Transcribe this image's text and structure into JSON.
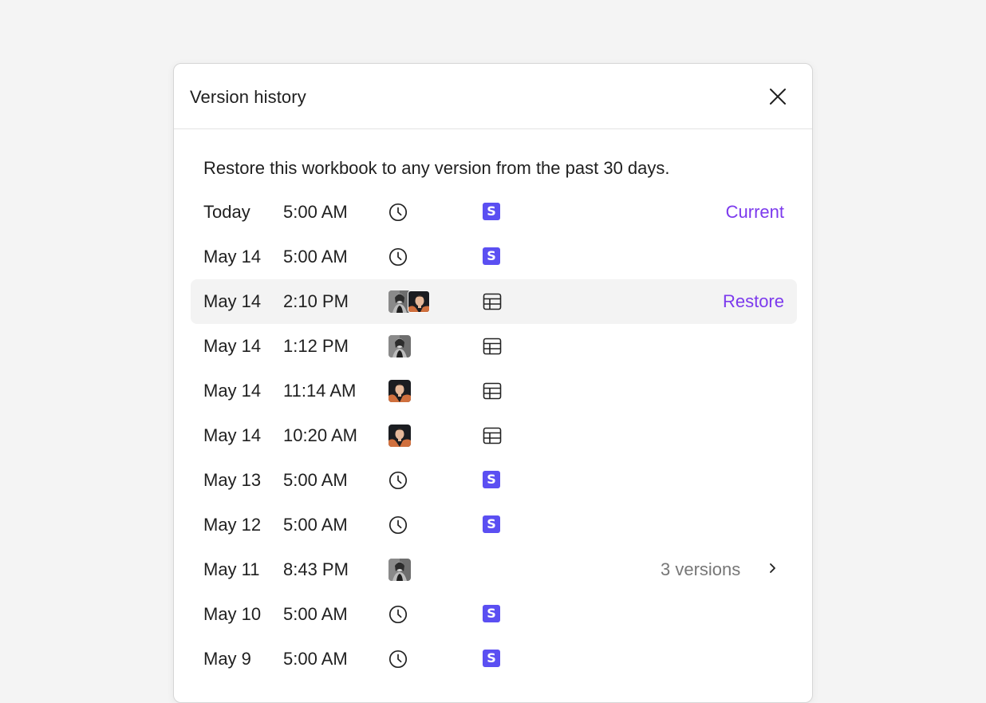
{
  "dialog": {
    "title": "Version history",
    "description": "Restore this workbook to any version from the past 30 days."
  },
  "colors": {
    "accent": "#7c3aed",
    "source_badge": "#5b4ff2",
    "selected_row": "#f3f3f3"
  },
  "versions": [
    {
      "date": "Today",
      "time": "5:00 AM",
      "author": "clock-icon",
      "source": "s-badge-icon",
      "action": "Current"
    },
    {
      "date": "May 14",
      "time": "5:00 AM",
      "author": "clock-icon",
      "source": "s-badge-icon"
    },
    {
      "date": "May 14",
      "time": "2:10 PM",
      "author": "avatar-woman+avatar-man",
      "source": "table-icon",
      "action": "Restore",
      "selected": true
    },
    {
      "date": "May 14",
      "time": "1:12 PM",
      "author": "avatar-woman",
      "source": "table-icon"
    },
    {
      "date": "May 14",
      "time": "11:14 AM",
      "author": "avatar-man",
      "source": "table-icon"
    },
    {
      "date": "May 14",
      "time": "10:20 AM",
      "author": "avatar-man",
      "source": "table-icon"
    },
    {
      "date": "May 13",
      "time": "5:00 AM",
      "author": "clock-icon",
      "source": "s-badge-icon"
    },
    {
      "date": "May 12",
      "time": "5:00 AM",
      "author": "clock-icon",
      "source": "s-badge-icon"
    },
    {
      "date": "May 11",
      "time": "8:43 PM",
      "author": "avatar-woman",
      "group_label": "3 versions"
    },
    {
      "date": "May 10",
      "time": "5:00 AM",
      "author": "clock-icon",
      "source": "s-badge-icon"
    },
    {
      "date": "May 9",
      "time": "5:00 AM",
      "author": "clock-icon",
      "source": "s-badge-icon"
    }
  ],
  "badge_letter": "S"
}
